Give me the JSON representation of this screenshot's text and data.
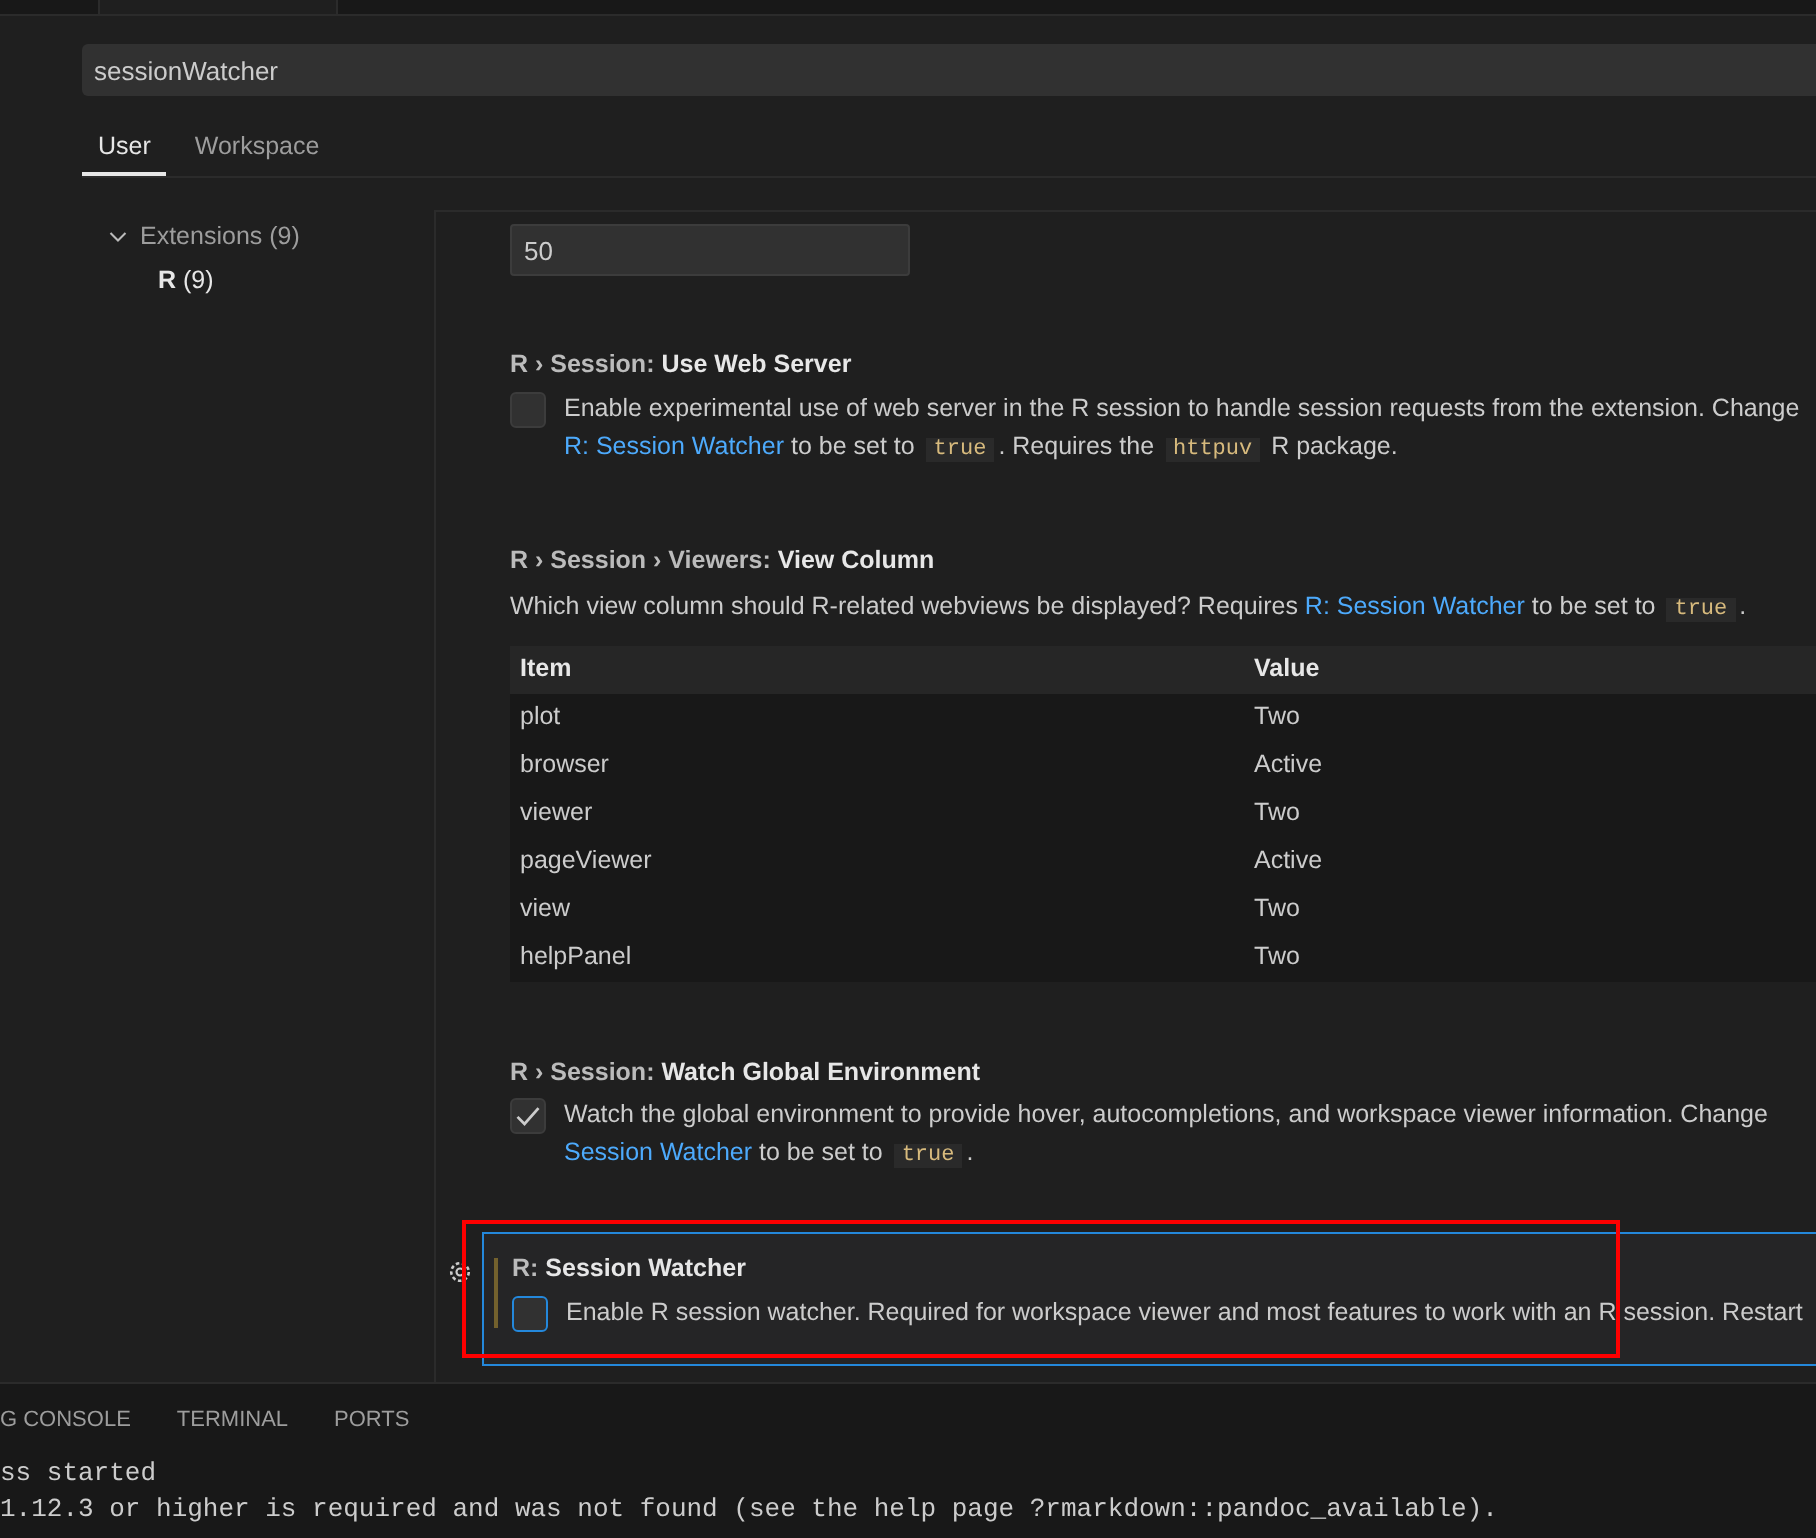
{
  "search": {
    "value": "sessionWatcher"
  },
  "scope_tabs": [
    {
      "label": "User",
      "selected": true
    },
    {
      "label": "Workspace",
      "selected": false
    }
  ],
  "toc": [
    {
      "label": "Extensions",
      "count": "(9)",
      "expanded": true,
      "children": [
        {
          "label": "R",
          "count": "(9)"
        }
      ]
    }
  ],
  "number_field": {
    "value": "50"
  },
  "settings": [
    {
      "kind": "checkbox",
      "category": "R › Session: ",
      "title": "Use Web Server",
      "checked": false,
      "focused": false,
      "modified": false,
      "lines": [
        [
          {
            "kind": "text",
            "text": "Enable experimental use of web server in the R session to handle session requests from the extension. Change"
          }
        ],
        [
          {
            "kind": "link",
            "text": "R: Session Watcher"
          },
          {
            "kind": "text",
            "text": " to be set to "
          },
          {
            "kind": "code",
            "text": "true"
          },
          {
            "kind": "text",
            "text": ". Requires the "
          },
          {
            "kind": "code",
            "text": "httpuv"
          },
          {
            "kind": "text",
            "text": " R package."
          }
        ]
      ]
    },
    {
      "kind": "table",
      "category": "R › Session › Viewers: ",
      "title": "View Column",
      "lines": [
        [
          {
            "kind": "text",
            "text": "Which view column should R-related webviews be displayed? Requires "
          },
          {
            "kind": "link",
            "text": "R: Session Watcher"
          },
          {
            "kind": "text",
            "text": " to be set to "
          },
          {
            "kind": "code",
            "text": "true"
          },
          {
            "kind": "text",
            "text": "."
          }
        ]
      ],
      "columns": [
        "Item",
        "Value"
      ],
      "rows": [
        [
          "plot",
          "Two"
        ],
        [
          "browser",
          "Active"
        ],
        [
          "viewer",
          "Two"
        ],
        [
          "pageViewer",
          "Active"
        ],
        [
          "view",
          "Two"
        ],
        [
          "helpPanel",
          "Two"
        ]
      ]
    },
    {
      "kind": "checkbox",
      "category": "R › Session: ",
      "title": "Watch Global Environment",
      "checked": true,
      "focused": false,
      "modified": false,
      "lines": [
        [
          {
            "kind": "text",
            "text": "Watch the global environment to provide hover, autocompletions, and workspace viewer information. Change"
          }
        ],
        [
          {
            "kind": "link",
            "text": "Session Watcher"
          },
          {
            "kind": "text",
            "text": " to be set to "
          },
          {
            "kind": "code",
            "text": "true"
          },
          {
            "kind": "text",
            "text": "."
          }
        ]
      ]
    },
    {
      "kind": "checkbox",
      "category": "R: ",
      "title": "Session Watcher",
      "checked": false,
      "focused": true,
      "modified": true,
      "lines": [
        [
          {
            "kind": "text",
            "text": "Enable R session watcher. Required for workspace viewer and most features to work with an R session. Restart"
          }
        ]
      ]
    }
  ],
  "panel_tabs": [
    {
      "label": "G CONSOLE",
      "selected": false
    },
    {
      "label": "TERMINAL",
      "selected": false
    },
    {
      "label": "PORTS",
      "selected": false
    }
  ],
  "terminal_lines": [
    "ss started",
    "1.12.3 or higher is required and was not found (see the help page ?rmarkdown::pandoc_available)."
  ]
}
